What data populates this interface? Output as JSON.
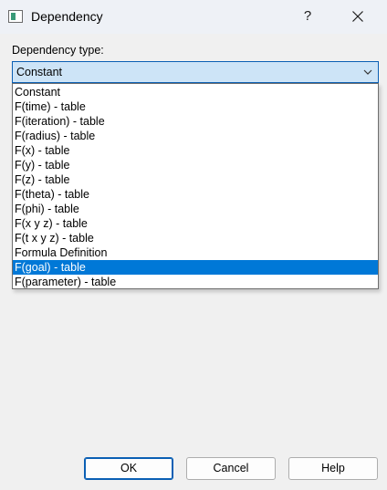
{
  "window": {
    "title": "Dependency",
    "help_label": "?"
  },
  "icons": {
    "app": "app-window-icon",
    "close": "close-icon",
    "dropdown": "chevron-down-icon"
  },
  "dependency": {
    "label": "Dependency type:",
    "selected_value": "Constant",
    "options": [
      "Constant",
      "F(time) - table",
      "F(iteration) - table",
      "F(radius) - table",
      "F(x) - table",
      "F(y) - table",
      "F(z) - table",
      "F(theta) - table",
      "F(phi) - table",
      "F(x y z) - table",
      "F(t x y z) - table",
      "Formula Definition",
      "F(goal) - table",
      "F(parameter) - table"
    ],
    "highlighted_option": "F(goal) - table"
  },
  "buttons": {
    "ok": "OK",
    "cancel": "Cancel",
    "help": "Help"
  },
  "colors": {
    "accent": "#0078d7",
    "combo_border": "#0a5fb4",
    "combo_bg": "#cde4f7",
    "dialog_bg": "#f0f0f0"
  }
}
